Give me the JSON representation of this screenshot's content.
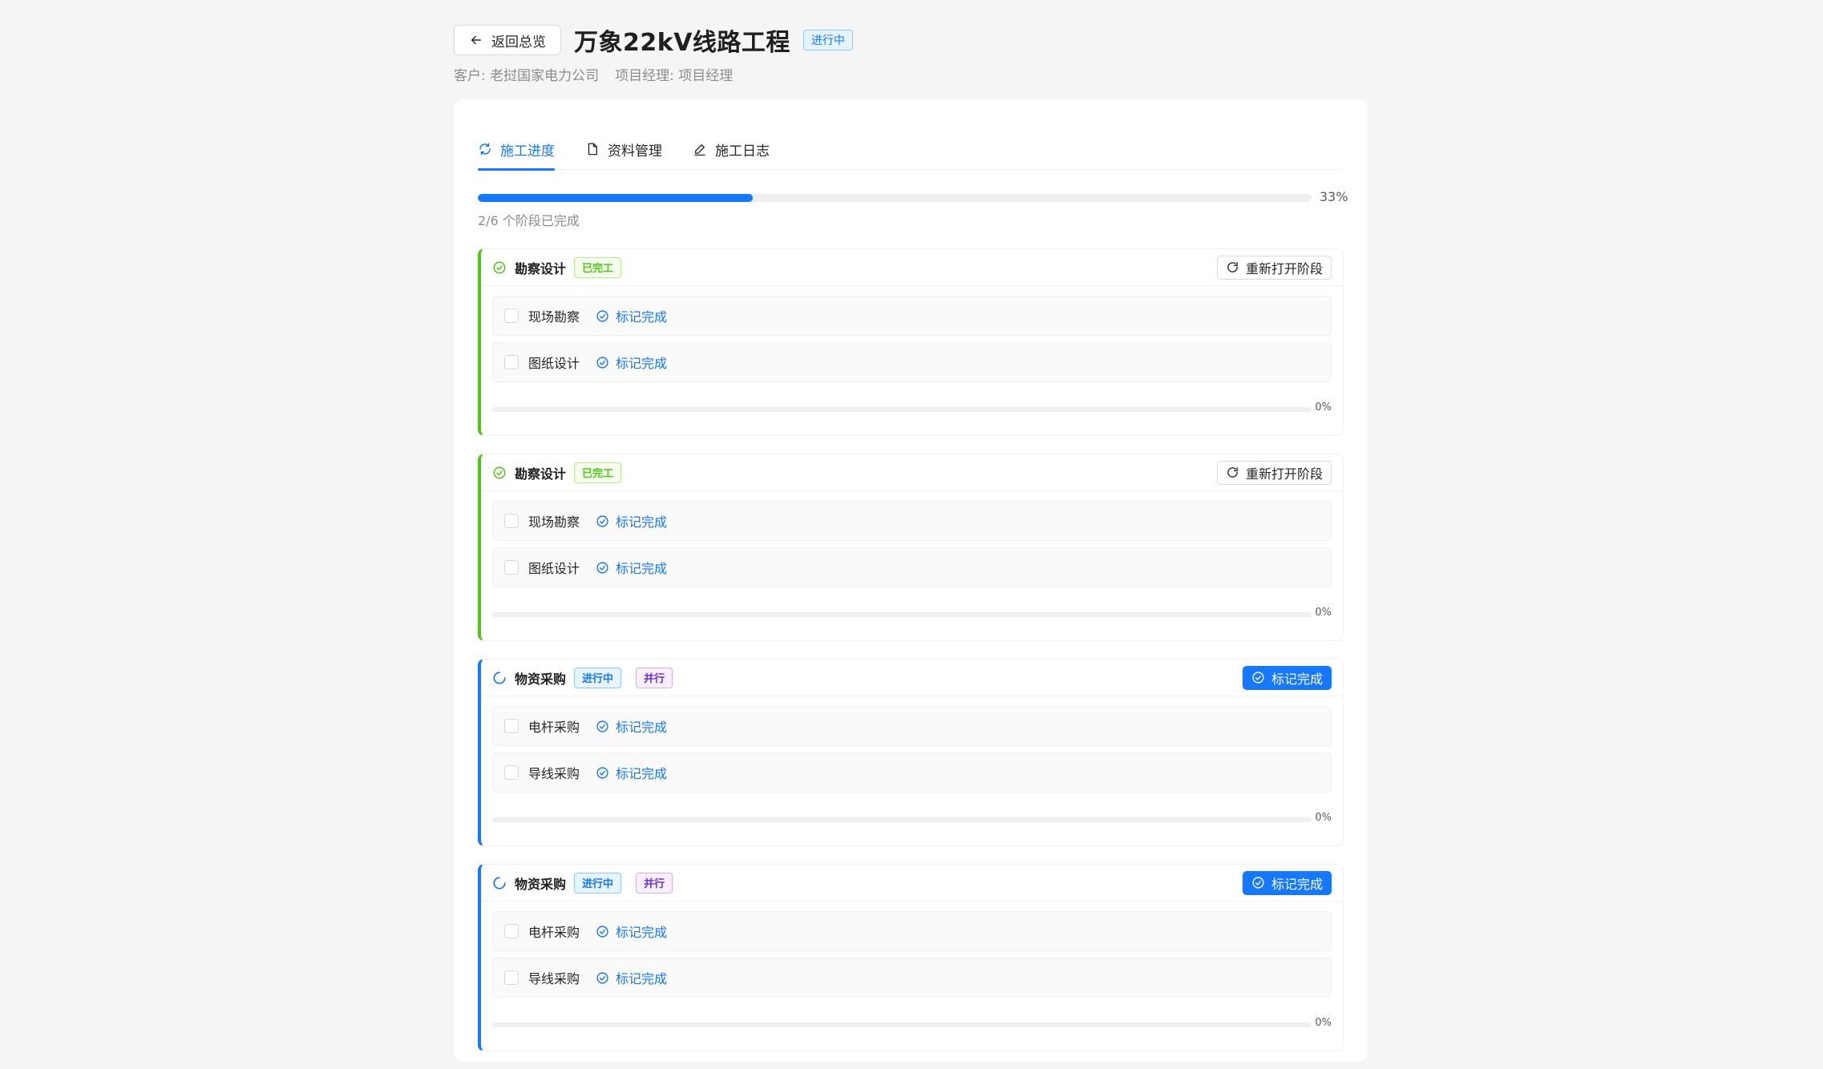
{
  "header": {
    "back_label": "返回总览",
    "title": "万象22kV线路工程",
    "status": "进行中",
    "customer": "客户: 老挝国家电力公司",
    "manager": "项目经理: 项目经理"
  },
  "tabs": [
    {
      "label": "施工进度",
      "icon": "sync-icon",
      "active": true
    },
    {
      "label": "资料管理",
      "icon": "file-icon",
      "active": false
    },
    {
      "label": "施工日志",
      "icon": "edit-icon",
      "active": false
    }
  ],
  "overall": {
    "percent_label": "33%",
    "fraction": 0.33,
    "summary": "2/6 个阶段已完成"
  },
  "colors": {
    "primary": "#1677ff",
    "success": "#52c41a",
    "purple": "#722ed1"
  },
  "phases": [
    {
      "name": "勘察设计",
      "status": "已完工",
      "state": "done",
      "parallel": "",
      "action": "重新打开阶段",
      "tasks": [
        {
          "name": "现场勘察",
          "link": "标记完成"
        },
        {
          "name": "图纸设计",
          "link": "标记完成"
        }
      ],
      "progress_label": "0%",
      "progress": 0
    },
    {
      "name": "勘察设计",
      "status": "已完工",
      "state": "done",
      "parallel": "",
      "action": "重新打开阶段",
      "tasks": [
        {
          "name": "现场勘察",
          "link": "标记完成"
        },
        {
          "name": "图纸设计",
          "link": "标记完成"
        }
      ],
      "progress_label": "0%",
      "progress": 0
    },
    {
      "name": "物资采购",
      "status": "进行中",
      "state": "doing",
      "parallel": "并行",
      "action": "标记完成",
      "tasks": [
        {
          "name": "电杆采购",
          "link": "标记完成"
        },
        {
          "name": "导线采购",
          "link": "标记完成"
        }
      ],
      "progress_label": "0%",
      "progress": 0
    },
    {
      "name": "物资采购",
      "status": "进行中",
      "state": "doing",
      "parallel": "并行",
      "action": "标记完成",
      "tasks": [
        {
          "name": "电杆采购",
          "link": "标记完成"
        },
        {
          "name": "导线采购",
          "link": "标记完成"
        }
      ],
      "progress_label": "0%",
      "progress": 0
    }
  ]
}
